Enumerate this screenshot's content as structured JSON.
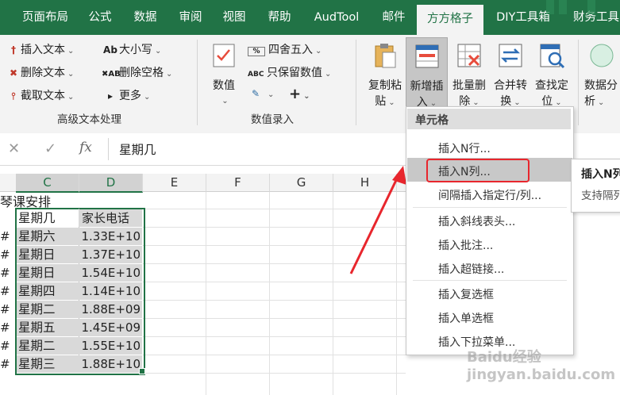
{
  "tabs": [
    "页面布局",
    "公式",
    "数据",
    "审阅",
    "视图",
    "帮助",
    "AudTool",
    "邮件",
    "方方格子",
    "DIY工具箱",
    "财务工具"
  ],
  "active_tab": "方方格子",
  "ribbon": {
    "text_group": {
      "insert_text": "插入文本",
      "delete_text": "删除文本",
      "cut_text": "截取文本",
      "case": "大小写",
      "delete_space": "删除空格",
      "more": "更多",
      "label": "高级文本处理"
    },
    "value_group": {
      "value_btn": "数值",
      "round": "四舍五入",
      "keep_value": "只保留数值",
      "plus": "+",
      "label": "数值录入"
    },
    "copy_paste": [
      "复制粘",
      "贴"
    ],
    "insert_new": [
      "新增插",
      "入"
    ],
    "batch_delete": [
      "批量删",
      "除"
    ],
    "merge_convert": [
      "合并转",
      "换"
    ],
    "find_locate": [
      "查找定",
      "位"
    ],
    "data_analysis": [
      "数据分",
      "析"
    ]
  },
  "formula_bar": {
    "fx": "fx",
    "content": "星期几"
  },
  "columns": [
    "C",
    "D",
    "E",
    "F",
    "G",
    "H"
  ],
  "sheet": {
    "title_fragment": "琴课安排",
    "header_c": "星期几",
    "header_d": "家长电话",
    "rows": [
      {
        "day": "星期六",
        "phone": "1.33E+10"
      },
      {
        "day": "星期日",
        "phone": "1.37E+10"
      },
      {
        "day": "星期日",
        "phone": "1.54E+10"
      },
      {
        "day": "星期四",
        "phone": "1.14E+10"
      },
      {
        "day": "星期二",
        "phone": "1.88E+09"
      },
      {
        "day": "星期五",
        "phone": "1.45E+09"
      },
      {
        "day": "星期二",
        "phone": "1.55E+10"
      },
      {
        "day": "星期三",
        "phone": "1.88E+10"
      }
    ],
    "hash": "#"
  },
  "dropdown": {
    "header": "单元格",
    "items": [
      "插入N行...",
      "插入N列...",
      "间隔插入指定行/列...",
      "插入斜线表头...",
      "插入批注...",
      "插入超链接...",
      "插入复选框",
      "插入单选框",
      "插入下拉菜单..."
    ]
  },
  "tooltip": {
    "title": "插入N列",
    "body": "支持隔列"
  },
  "watermark": "Baidu经验 jingyan.baidu.com",
  "colors": {
    "excel_green": "#217346",
    "highlight_red": "#e8262d",
    "arrow_red": "#e8262d"
  }
}
